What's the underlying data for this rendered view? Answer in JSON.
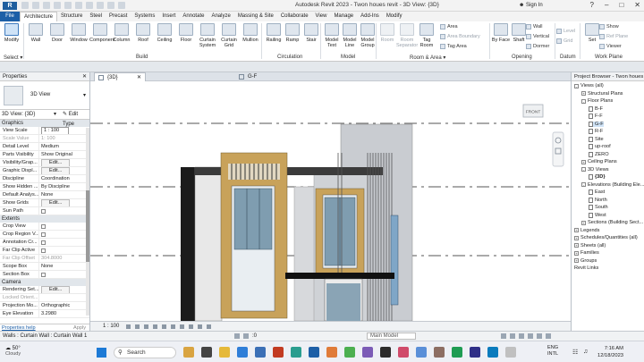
{
  "app": {
    "title": "Autodesk Revit 2023 - Twon houes revit - 3D View: {3D}",
    "sign_in": "Sign In",
    "logo": "R"
  },
  "tabs": [
    "File",
    "Architecture",
    "Structure",
    "Steel",
    "Precast",
    "Systems",
    "Insert",
    "Annotate",
    "Analyze",
    "Massing & Site",
    "Collaborate",
    "View",
    "Manage",
    "Add-Ins",
    "Modify"
  ],
  "active_tab": "Architecture",
  "ribbon": {
    "select": {
      "modify": "Modify",
      "panel": "Select"
    },
    "build": {
      "panel": "Build",
      "buttons": [
        "Wall",
        "Door",
        "Window",
        "Component",
        "Column",
        "Roof",
        "Ceiling",
        "Floor",
        "Curtain System",
        "Curtain Grid",
        "Mullion"
      ]
    },
    "circulation": {
      "panel": "Circulation",
      "buttons": [
        "Railing",
        "Ramp",
        "Stair"
      ]
    },
    "model": {
      "panel": "Model",
      "buttons": [
        "Model Text",
        "Model Line",
        "Model Group"
      ]
    },
    "room_area": {
      "panel": "Room & Area",
      "buttons": [
        "Room",
        "Room Separator",
        "Tag Room"
      ],
      "small": [
        "Area",
        "Area Boundary",
        "Tag Area"
      ]
    },
    "opening": {
      "panel": "Opening",
      "buttons": [
        "By Face",
        "Shaft"
      ],
      "small": [
        "Wall",
        "Vertical",
        "Dormer"
      ]
    },
    "datum": {
      "panel": "Datum",
      "small": [
        "Level",
        "Grid"
      ]
    },
    "work_plane": {
      "panel": "Work Plane",
      "buttons": [
        "Set"
      ],
      "small": [
        "Show",
        "Ref Plane",
        "Viewer"
      ]
    }
  },
  "properties": {
    "header": "Properties",
    "type_name": "3D View",
    "selector": "3D View: {3D}",
    "edit_type": "Edit Type",
    "sections": [
      {
        "name": "Graphics",
        "rows": [
          {
            "k": "View Scale",
            "v": "1 : 100",
            "kind": "input"
          },
          {
            "k": "Scale Value",
            "v": "1: 100",
            "kind": "dim"
          },
          {
            "k": "Detail Level",
            "v": "Medium"
          },
          {
            "k": "Parts Visibility",
            "v": "Show Original"
          },
          {
            "k": "Visibility/Grap...",
            "v": "Edit...",
            "kind": "button"
          },
          {
            "k": "Graphic Displ...",
            "v": "Edit...",
            "kind": "button"
          },
          {
            "k": "Discipline",
            "v": "Coordination"
          },
          {
            "k": "Show Hidden ...",
            "v": "By Discipline"
          },
          {
            "k": "Default Analys...",
            "v": "None"
          },
          {
            "k": "Show Grids",
            "v": "Edit...",
            "kind": "button"
          },
          {
            "k": "Sun Path",
            "v": "",
            "kind": "check"
          }
        ]
      },
      {
        "name": "Extents",
        "rows": [
          {
            "k": "Crop View",
            "v": "",
            "kind": "check"
          },
          {
            "k": "Crop Region V...",
            "v": "",
            "kind": "check"
          },
          {
            "k": "Annotation Cr...",
            "v": "",
            "kind": "check"
          },
          {
            "k": "Far Clip Active",
            "v": "",
            "kind": "check"
          },
          {
            "k": "Far Clip Offset",
            "v": "304.8000",
            "kind": "dim"
          },
          {
            "k": "Scope Box",
            "v": "None"
          },
          {
            "k": "Section Box",
            "v": "",
            "kind": "check"
          }
        ]
      },
      {
        "name": "Camera",
        "rows": [
          {
            "k": "Rendering Set...",
            "v": "Edit...",
            "kind": "button"
          },
          {
            "k": "Locked Orient...",
            "v": "",
            "kind": "dim"
          },
          {
            "k": "Projection Mo...",
            "v": "Orthographic"
          },
          {
            "k": "Eye Elevation",
            "v": "3.2980"
          }
        ]
      }
    ],
    "help_link": "Properties help",
    "apply": "Apply"
  },
  "view_tabs": [
    {
      "label": "{3D}",
      "active": true
    },
    {
      "label": "G-F",
      "active": false
    }
  ],
  "viewcube": {
    "face": "FRONT"
  },
  "view_scale": "1 : 100",
  "project_browser": {
    "header": "Project Browser - Twon houes revit",
    "items": [
      {
        "label": "Views (all)",
        "level": 0,
        "toggle": "-",
        "bold": false
      },
      {
        "label": "Structural Plans",
        "level": 1,
        "toggle": "+"
      },
      {
        "label": "Floor Plans",
        "level": 1,
        "toggle": "-"
      },
      {
        "label": "B-F",
        "level": 2,
        "page": true
      },
      {
        "label": "F-F",
        "level": 2,
        "page": true
      },
      {
        "label": "G-F",
        "level": 2,
        "page": true
      },
      {
        "label": "R-F",
        "level": 2,
        "page": true
      },
      {
        "label": "Site",
        "level": 2,
        "page": true
      },
      {
        "label": "up-roof",
        "level": 2,
        "page": true
      },
      {
        "label": "ZERO",
        "level": 2,
        "page": true
      },
      {
        "label": "Ceiling Plans",
        "level": 1,
        "toggle": "+"
      },
      {
        "label": "3D Views",
        "level": 1,
        "toggle": "-"
      },
      {
        "label": "{3D}",
        "level": 2,
        "page": true,
        "bold": true
      },
      {
        "label": "Elevations (Building Ele...",
        "level": 1,
        "toggle": "-"
      },
      {
        "label": "East",
        "level": 2,
        "page": true
      },
      {
        "label": "North",
        "level": 2,
        "page": true
      },
      {
        "label": "South",
        "level": 2,
        "page": true
      },
      {
        "label": "West",
        "level": 2,
        "page": true
      },
      {
        "label": "Sections (Building Sect...",
        "level": 1,
        "toggle": "+"
      },
      {
        "label": "Legends",
        "level": 0,
        "toggle": "+"
      },
      {
        "label": "Schedules/Quantities (all)",
        "level": 0,
        "toggle": "+"
      },
      {
        "label": "Sheets (all)",
        "level": 0,
        "toggle": "+"
      },
      {
        "label": "Families",
        "level": 0,
        "toggle": "+"
      },
      {
        "label": "Groups",
        "level": 0,
        "toggle": "+"
      },
      {
        "label": "Revit Links",
        "level": 0,
        "toggle": ""
      }
    ]
  },
  "status_bar": {
    "message": "Walls : Curtain Wall : Curtain Wall 1",
    "model": "Main Model",
    "zero": ":0"
  },
  "taskbar": {
    "weather_temp": "50°",
    "weather_text": "Cloudy",
    "search": "Search",
    "lang1": "ENG",
    "lang2": "INTL",
    "time": "7:16 AM",
    "date": "12/18/2023"
  },
  "colors": {
    "accent": "#1d5fa7",
    "tan_frame": "#c8a25a",
    "glass": "#7f9db0",
    "dark": "#222222",
    "facade": "#c9ccd1"
  }
}
